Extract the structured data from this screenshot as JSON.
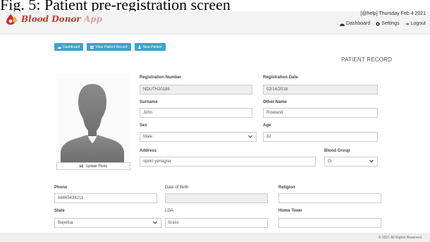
{
  "caption": "Fig. 5: Patient pre-registration screen",
  "header": {
    "logo_text": "Blood Donor",
    "logo_suffix": " App",
    "help_date": "[@help] Thursday Feb 4 2021",
    "links": {
      "dashboard": "Dashboard",
      "settings": "Settings",
      "logout": "Logout"
    }
  },
  "toolbar": {
    "dashboard": "Dashboard",
    "view_patient_record": "View Patient Record",
    "new_patient": "New Patient"
  },
  "page_title": "PATIENT RECORD",
  "photo": {
    "update_label": "Update Photo"
  },
  "form": {
    "registration_number": {
      "label": "Registration Number",
      "value": "NDUTH20188"
    },
    "registration_date": {
      "label": "Registration Date",
      "value": "02/14/2018"
    },
    "surname": {
      "label": "Surname",
      "value": "John"
    },
    "other_name": {
      "label": "Other Name",
      "value": "Rowland"
    },
    "sex": {
      "label": "Sex",
      "value": "Male"
    },
    "age": {
      "label": "Age",
      "value": "32"
    },
    "address": {
      "label": "Address",
      "value": "opolo yenagoa"
    },
    "blood_group": {
      "label": "Blood Group",
      "value": "O-"
    },
    "phone": {
      "label": "Phone",
      "value": "88865438211"
    },
    "date_of_birth": {
      "label": "Date of Birth",
      "value": ""
    },
    "religion": {
      "label": "Religion",
      "value": ""
    },
    "state": {
      "label": "State",
      "value": "Bayelsa"
    },
    "lga": {
      "label": "LGA",
      "value": "brass"
    },
    "home_town": {
      "label": "Home Town",
      "value": ""
    }
  },
  "footer": "© 2021 All Rights Reserved",
  "colors": {
    "accent": "#3aa3cf",
    "brand": "#c0392b",
    "readonly_bg": "#eeeeee"
  }
}
